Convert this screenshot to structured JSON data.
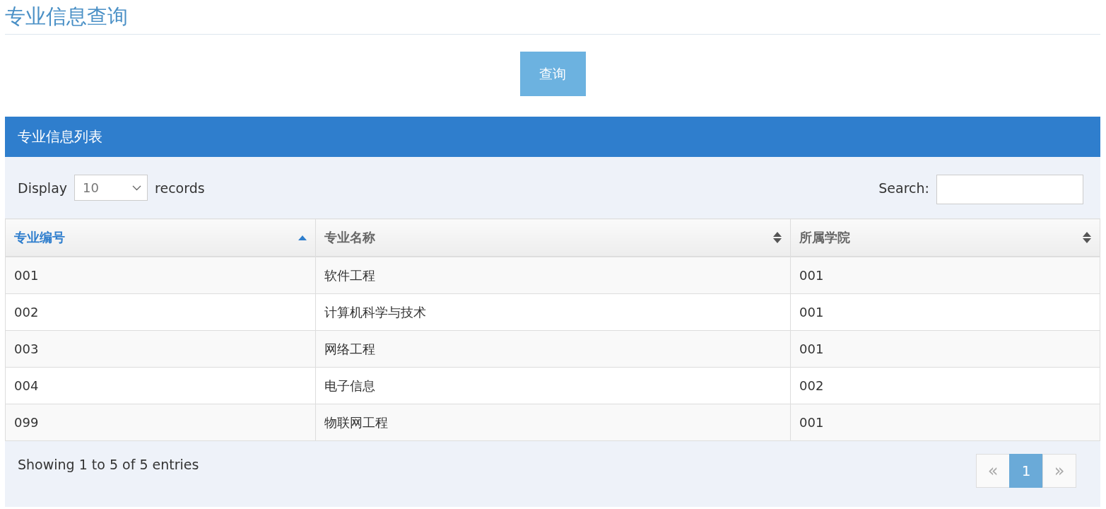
{
  "page_title": "专业信息查询",
  "query_button": "查询",
  "panel": {
    "title": "专业信息列表",
    "length": {
      "label_before": "Display",
      "value": "10",
      "label_after": "records"
    },
    "search": {
      "label": "Search:"
    },
    "table": {
      "columns": [
        {
          "label": "专业编号",
          "sorted": true
        },
        {
          "label": "专业名称",
          "sorted": false
        },
        {
          "label": "所属学院",
          "sorted": false
        }
      ],
      "rows": [
        [
          "001",
          "软件工程",
          "001"
        ],
        [
          "002",
          "计算机科学与技术",
          "001"
        ],
        [
          "003",
          "网络工程",
          "001"
        ],
        [
          "004",
          "电子信息",
          "002"
        ],
        [
          "099",
          "物联网工程",
          "001"
        ]
      ]
    },
    "info": "Showing 1 to 5 of 5 entries",
    "pagination": [
      {
        "label": "«",
        "kind": "prev",
        "selected": false,
        "disabled": true
      },
      {
        "label": "1",
        "kind": "page",
        "selected": true,
        "disabled": false
      },
      {
        "label": "»",
        "kind": "next",
        "selected": false,
        "disabled": true
      }
    ]
  }
}
